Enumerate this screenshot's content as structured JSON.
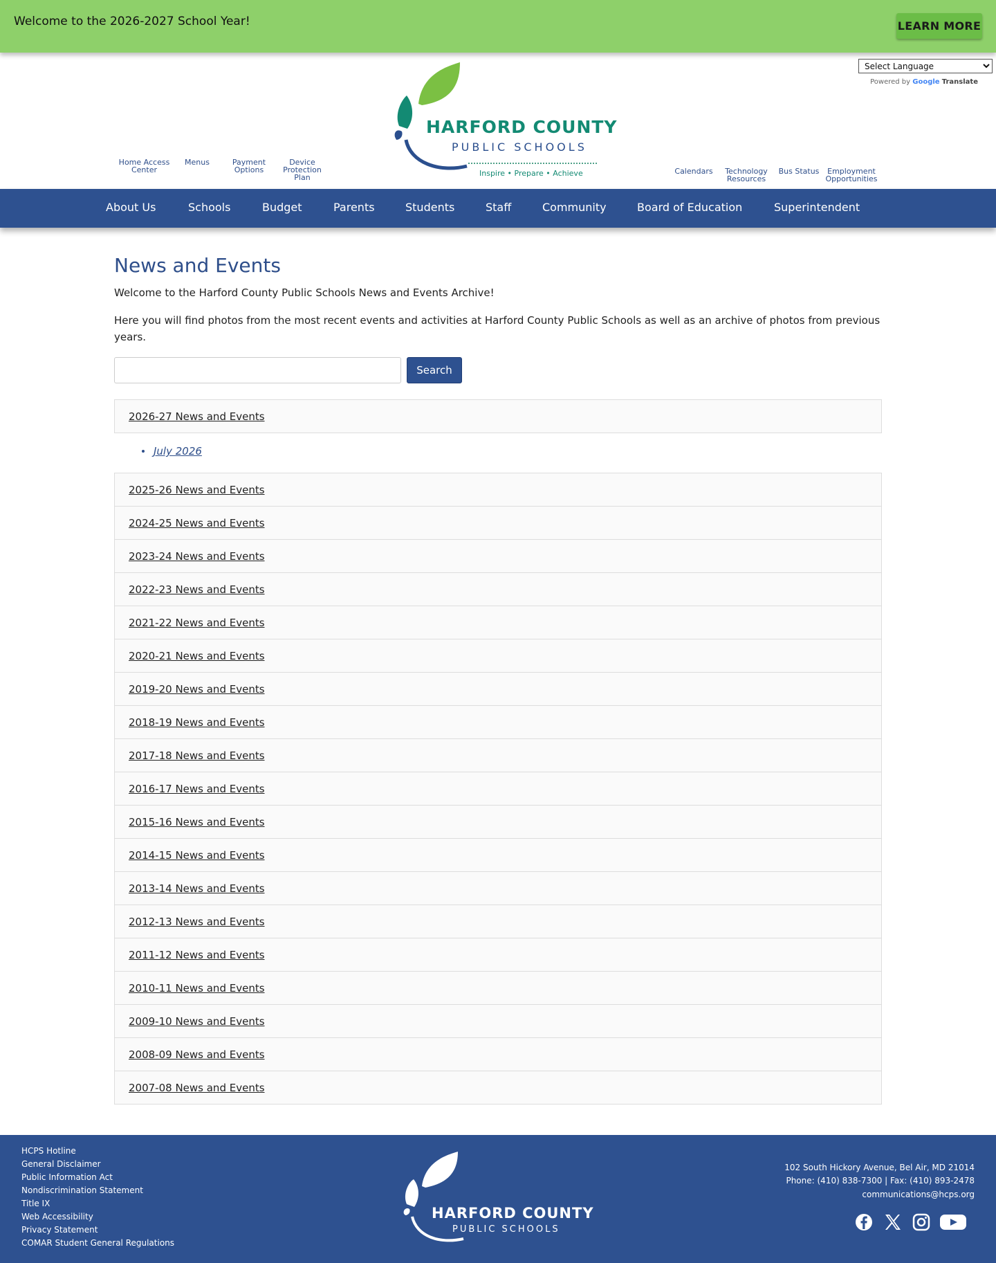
{
  "alert": {
    "text": "Welcome to the 2026-2027 School Year!",
    "button": "LEARN MORE"
  },
  "translate": {
    "select_value": "Select Language",
    "powered_by": "Powered by",
    "google": "Google",
    "translate": "Translate"
  },
  "utility_left": [
    {
      "line1": "Home Access",
      "line2": "Center",
      "line3": ""
    },
    {
      "line1": "Menus",
      "line2": "",
      "line3": ""
    },
    {
      "line1": "Payment",
      "line2": "Options",
      "line3": ""
    },
    {
      "line1": "Device",
      "line2": "Protection",
      "line3": "Plan"
    }
  ],
  "utility_right": [
    {
      "line1": "Calendars",
      "line2": ""
    },
    {
      "line1": "Technology",
      "line2": "Resources"
    },
    {
      "line1": "Bus Status",
      "line2": ""
    },
    {
      "line1": "Employment",
      "line2": "Opportunities"
    }
  ],
  "logo": {
    "title": "HARFORD COUNTY",
    "subtitle": "PUBLIC SCHOOLS",
    "tagline": "Inspire • Prepare • Achieve"
  },
  "nav": [
    "About Us",
    "Schools",
    "Budget",
    "Parents",
    "Students",
    "Staff",
    "Community",
    "Board of Education",
    "Superintendent"
  ],
  "main": {
    "title": "News and Events",
    "intro1": "Welcome to the Harford County Public Schools News and Events Archive!",
    "intro2": "Here you will find photos from the most recent events and activities at Harford County Public Schools as well as an archive of photos from previous years.",
    "search_value": "",
    "search_button": "Search",
    "sublink": "July 2026",
    "years": [
      "2026-27 News and Events",
      "2025-26 News and Events",
      "2024-25 News and Events",
      "2023-24 News and Events",
      "2022-23 News and Events",
      "2021-22 News and Events",
      "2020-21 News and Events",
      "2019-20 News and Events",
      "2018-19 News and Events",
      "2017-18 News and Events",
      "2016-17 News and Events",
      "2015-16 News and Events",
      "2014-15 News and Events",
      "2013-14 News and Events",
      "2012-13 News and Events",
      "2011-12 News and Events",
      "2010-11 News and Events",
      "2009-10 News and Events",
      "2008-09 News and Events",
      "2007-08 News and Events"
    ]
  },
  "footer": {
    "links": [
      "HCPS Hotline",
      "General Disclaimer",
      "Public Information Act",
      "Nondiscrimination Statement",
      "Title IX",
      "Web Accessibility",
      "Privacy Statement",
      "COMAR Student General Regulations"
    ],
    "address": "102 South Hickory Avenue, Bel Air, MD 21014",
    "phone": "Phone: (410) 838-7300 | Fax: (410) 893-2478",
    "email": "communications@hcps.org",
    "logo_title": "HARFORD COUNTY",
    "logo_subtitle": "PUBLIC SCHOOLS",
    "social": [
      "facebook-icon",
      "x-icon",
      "instagram-icon",
      "youtube-icon"
    ]
  },
  "colors": {
    "alert_bg": "#8ed06a",
    "nav_bg": "#2e5190",
    "brand_green": "#138a73",
    "brand_blue": "#2b4f8e",
    "leaf_green": "#7bc043"
  }
}
